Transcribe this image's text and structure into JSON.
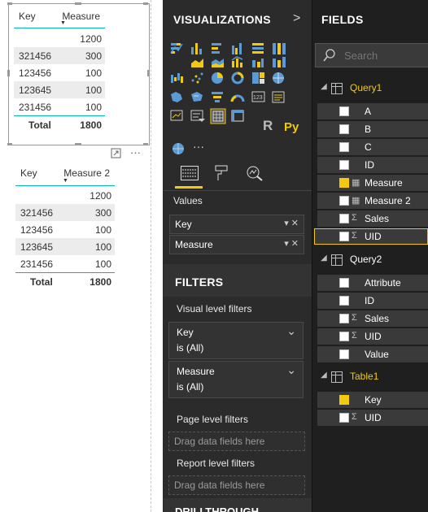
{
  "table_visual_1": {
    "headers": {
      "key": "Key",
      "measure": "Measure"
    },
    "rows": [
      {
        "key": "",
        "value": "1200"
      },
      {
        "key": "321456",
        "value": "300"
      },
      {
        "key": "123456",
        "value": "100"
      },
      {
        "key": "123645",
        "value": "100"
      },
      {
        "key": "231456",
        "value": "100"
      }
    ],
    "total": {
      "label": "Total",
      "value": "1800"
    }
  },
  "table_visual_2": {
    "headers": {
      "key": "Key",
      "measure": "Measure 2"
    },
    "rows": [
      {
        "key": "",
        "value": "1200"
      },
      {
        "key": "321456",
        "value": "300"
      },
      {
        "key": "123456",
        "value": "100"
      },
      {
        "key": "123645",
        "value": "100"
      },
      {
        "key": "231456",
        "value": "100"
      }
    ],
    "total": {
      "label": "Total",
      "value": "1800"
    },
    "more_glyph": "···"
  },
  "visualizations": {
    "title": "VISUALIZATIONS",
    "chevron": ">",
    "r_label": "R",
    "py_label": "Py",
    "ellipsis": "···",
    "values_label": "Values",
    "values_wells": [
      "Key",
      "Measure"
    ],
    "filters_title": "FILTERS",
    "visual_level_label": "Visual level filters",
    "visual_filters": [
      {
        "name": "Key",
        "state": "is (All)"
      },
      {
        "name": "Measure",
        "state": "is (All)"
      }
    ],
    "page_level_label": "Page level filters",
    "report_level_label": "Report level filters",
    "drop_hint": "Drag data fields here",
    "drillthrough_label": "DRILLTHROUGH"
  },
  "fields": {
    "title": "FIELDS",
    "search_placeholder": "Search",
    "tables": [
      {
        "name": "Query1",
        "fields": [
          {
            "name": "A",
            "type": "",
            "checked": false
          },
          {
            "name": "B",
            "type": "",
            "checked": false
          },
          {
            "name": "C",
            "type": "",
            "checked": false
          },
          {
            "name": "ID",
            "type": "",
            "checked": false
          },
          {
            "name": "Measure",
            "type": "calc",
            "checked": true
          },
          {
            "name": "Measure 2",
            "type": "calc",
            "checked": false
          },
          {
            "name": "Sales",
            "type": "Σ",
            "checked": false
          },
          {
            "name": "UID",
            "type": "Σ",
            "checked": false
          }
        ]
      },
      {
        "name": "Query2",
        "fields": [
          {
            "name": "Attribute",
            "type": "",
            "checked": false
          },
          {
            "name": "ID",
            "type": "",
            "checked": false
          },
          {
            "name": "Sales",
            "type": "Σ",
            "checked": false
          },
          {
            "name": "UID",
            "type": "Σ",
            "checked": false
          },
          {
            "name": "Value",
            "type": "",
            "checked": false
          }
        ]
      },
      {
        "name": "Table1",
        "fields": [
          {
            "name": "Key",
            "type": "",
            "checked": true
          },
          {
            "name": "UID",
            "type": "Σ",
            "checked": false
          }
        ]
      }
    ]
  },
  "colors": {
    "accent": "#f2c811",
    "teal": "#01b8aa",
    "pane_bg": "#2b2b2b"
  }
}
